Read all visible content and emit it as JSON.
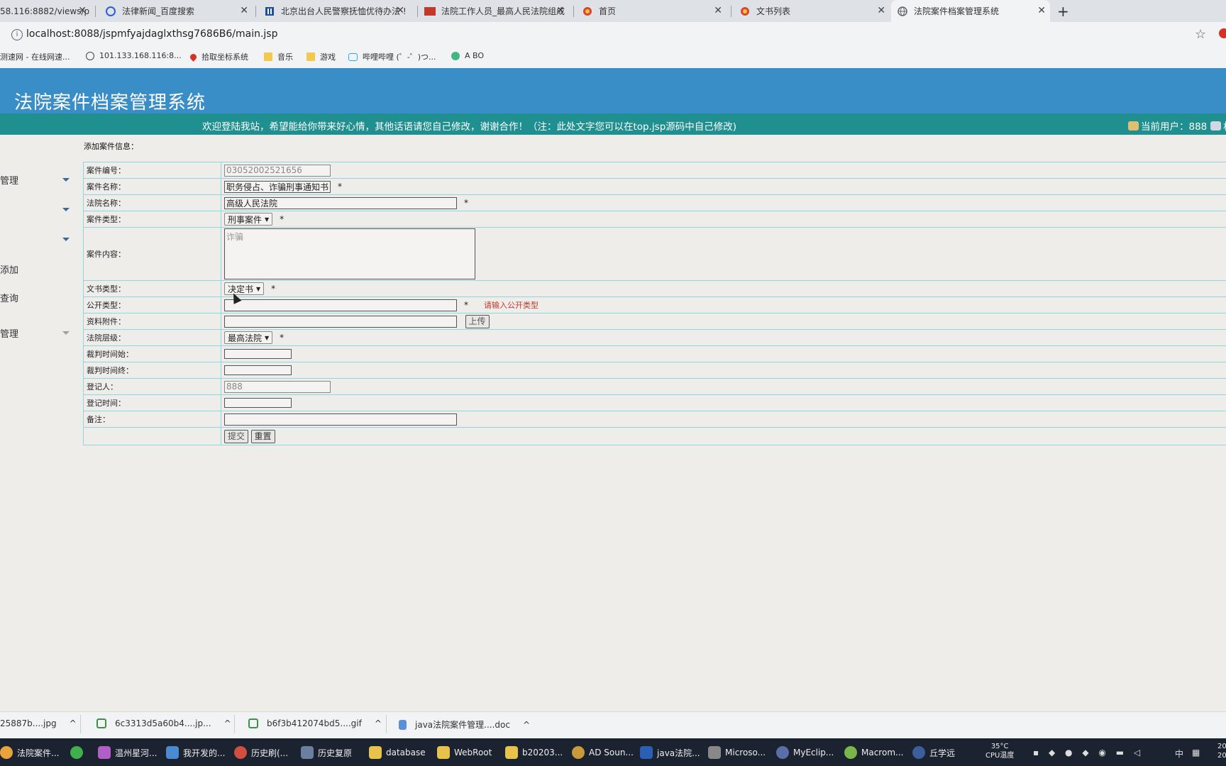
{
  "browser": {
    "tabs": [
      {
        "label": "58.116:8882/views/p",
        "icon": "globe-icon"
      },
      {
        "label": "法律新闻_百度搜索",
        "icon": "baidu-paw-icon"
      },
      {
        "label": "北京出台人民警察抚恤优待办法 !",
        "icon": "site-icon"
      },
      {
        "label": "法院工作人员_最高人民法院组成",
        "icon": "court-logo-icon"
      },
      {
        "label": "首页",
        "icon": "emblem-icon"
      },
      {
        "label": "文书列表",
        "icon": "emblem-icon"
      },
      {
        "label": "法院案件档案管理系统",
        "icon": "globe-icon"
      }
    ],
    "close_glyph": "✕",
    "newtab_glyph": "+",
    "address": "localhost:8088/jspmfyajdaglxthsg7686B6/main.jsp",
    "info_glyph": "i",
    "star_glyph": "☆",
    "bookmarks": [
      {
        "label": "测速网 - 在线网速...",
        "icon": "blank-icon"
      },
      {
        "label": "101.133.168.116:8...",
        "icon": "globe-icon"
      },
      {
        "label": "拾取坐标系统",
        "icon": "map-pin-icon"
      },
      {
        "label": "音乐",
        "icon": "folder-icon"
      },
      {
        "label": "游戏",
        "icon": "folder-icon"
      },
      {
        "label": "哔哩哔哩 (゜-゜)つ...",
        "icon": "bilibili-icon"
      },
      {
        "label": "A BO",
        "icon": "vue-icon"
      }
    ]
  },
  "app": {
    "title": "法院案件档案管理系统",
    "welcome": "欢迎登陆我站，希望能给你带来好心情，其他话语请您自己修改，谢谢合作！（注：此处文字您可以在top.jsp源码中自己修改)",
    "user_label": "当前用户：888",
    "user_extra": "权"
  },
  "sidebar": {
    "items": [
      "管理",
      "",
      "",
      "添加",
      "查询",
      "管理"
    ]
  },
  "form": {
    "heading": "添加案件信息：",
    "required_mark": "*",
    "fields": {
      "case_no": {
        "label": "案件编号：",
        "value": "03052002521656"
      },
      "case_name": {
        "label": "案件名称：",
        "value": "职务侵占、诈骗刑事通知书"
      },
      "court_name": {
        "label": "法院名称：",
        "value": "高级人民法院"
      },
      "case_type": {
        "label": "案件类型：",
        "value": "刑事案件"
      },
      "case_content": {
        "label": "案件内容：",
        "value": "诈骗"
      },
      "doc_type": {
        "label": "文书类型：",
        "value": "决定书"
      },
      "public_type": {
        "label": "公开类型：",
        "value": "",
        "error": "请输入公开类型"
      },
      "attachment": {
        "label": "资料附件：",
        "value": "",
        "button": "上传"
      },
      "court_level": {
        "label": "法院层级：",
        "value": "最高法院"
      },
      "trial_start": {
        "label": "裁判时间始：",
        "value": ""
      },
      "trial_end": {
        "label": "裁判时间终：",
        "value": ""
      },
      "registrar": {
        "label": "登记人：",
        "value": "888"
      },
      "register_time": {
        "label": "登记时间：",
        "value": ""
      },
      "remark": {
        "label": "备注：",
        "value": ""
      }
    },
    "submit": "提交",
    "reset": "重置"
  },
  "downloads": [
    {
      "label": "25887b....jpg",
      "icon": "image-file-icon"
    },
    {
      "label": "6c3313d5a60b4....jp...",
      "icon": "image-file-icon"
    },
    {
      "label": "b6f3b412074bd5....gif",
      "icon": "image-file-icon"
    },
    {
      "label": "java法院案件管理....doc",
      "icon": "doc-file-icon"
    }
  ],
  "download_chevron": "^",
  "taskbar": {
    "items": [
      {
        "label": "法院案件...",
        "color": "#e8a33d"
      },
      {
        "label": "",
        "color": "#3fb04b"
      },
      {
        "label": "温州星河...",
        "color": "#b05fc7"
      },
      {
        "label": "我开发的...",
        "color": "#4a8ad0"
      },
      {
        "label": "历史刷(...",
        "color": "#d0503f"
      },
      {
        "label": "历史复原",
        "color": "#6c7fa0"
      },
      {
        "label": "database",
        "color": "#e9c24b"
      },
      {
        "label": "WebRoot",
        "color": "#e9c24b"
      },
      {
        "label": "b20203...",
        "color": "#e9c24b"
      },
      {
        "label": "AD Soun...",
        "color": "#c89a3a"
      },
      {
        "label": "java法院...",
        "color": "#2b5fb4"
      },
      {
        "label": "Microso...",
        "color": "#888888"
      },
      {
        "label": "MyEclip...",
        "color": "#5a6fa8"
      },
      {
        "label": "Macrom...",
        "color": "#7ab648"
      },
      {
        "label": "丘学远",
        "color": "#3a5f9a"
      }
    ],
    "temp": "35°C",
    "cpu": "CPU温度",
    "ime": "中",
    "clock1": "20",
    "clock2": "20"
  }
}
